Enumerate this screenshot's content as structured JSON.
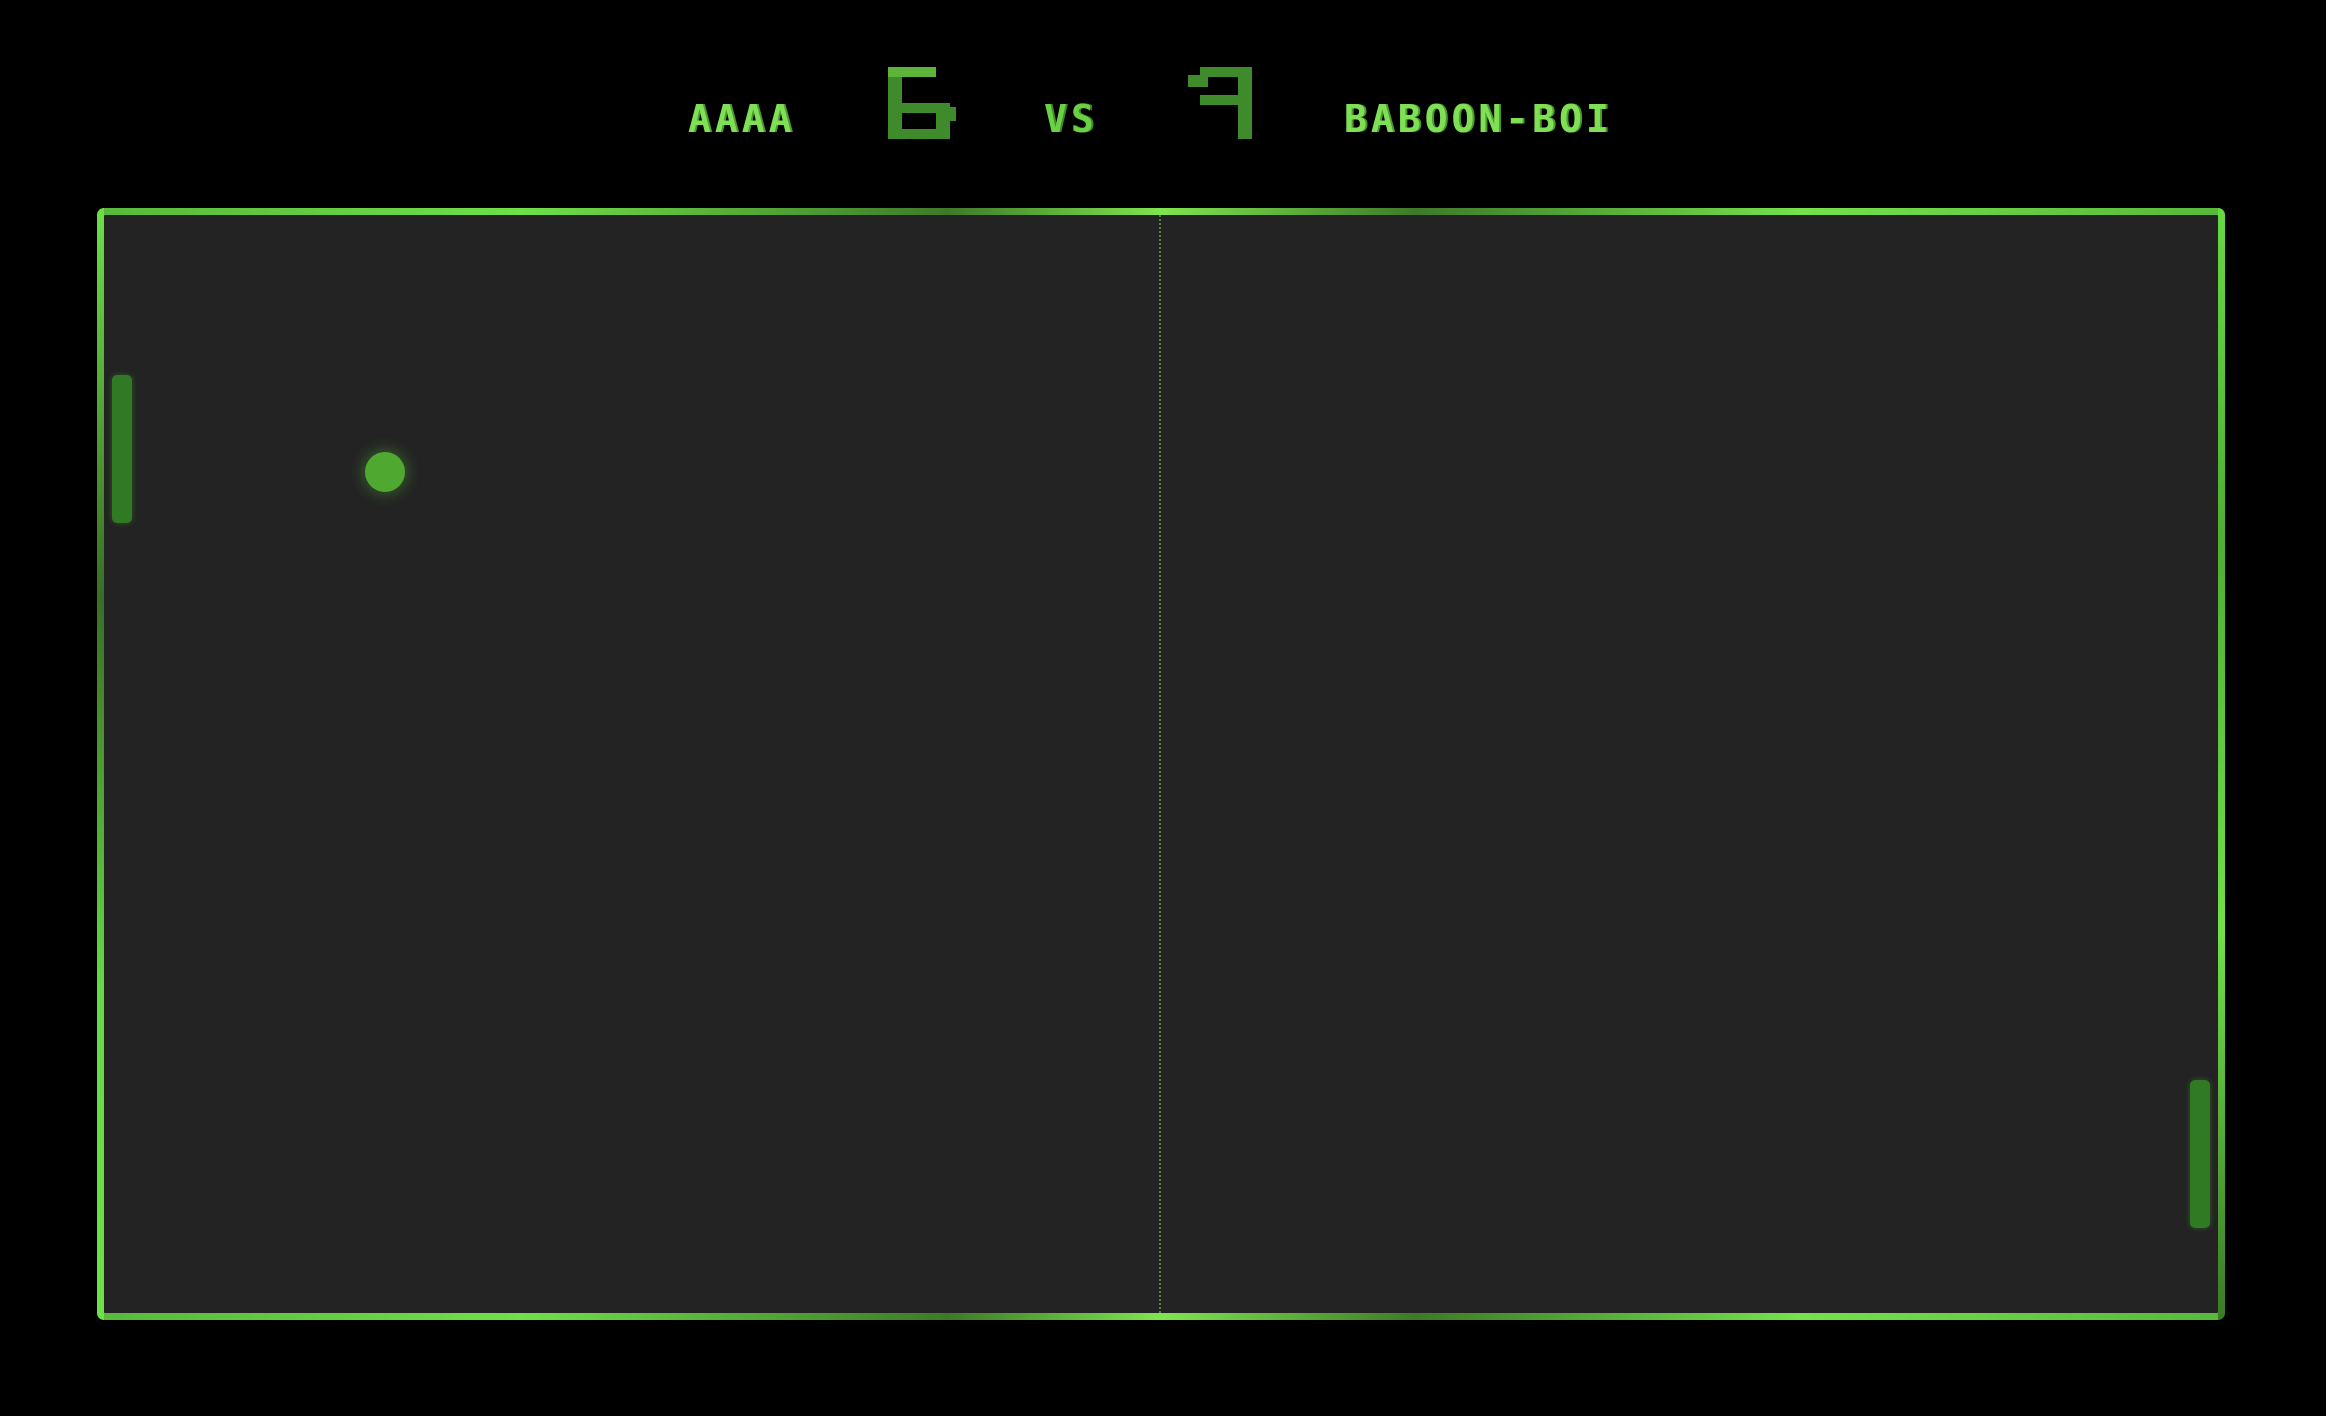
{
  "scoreboard": {
    "player_left": "AAAA",
    "score_left": "6",
    "vs_label": "VS",
    "score_right": "9",
    "player_right": "BABOON-BOI"
  },
  "colors": {
    "background": "#000000",
    "court": "#232323",
    "accent": "#6fe048",
    "paddle": "#2f7a22",
    "ball": "#4fa830"
  }
}
